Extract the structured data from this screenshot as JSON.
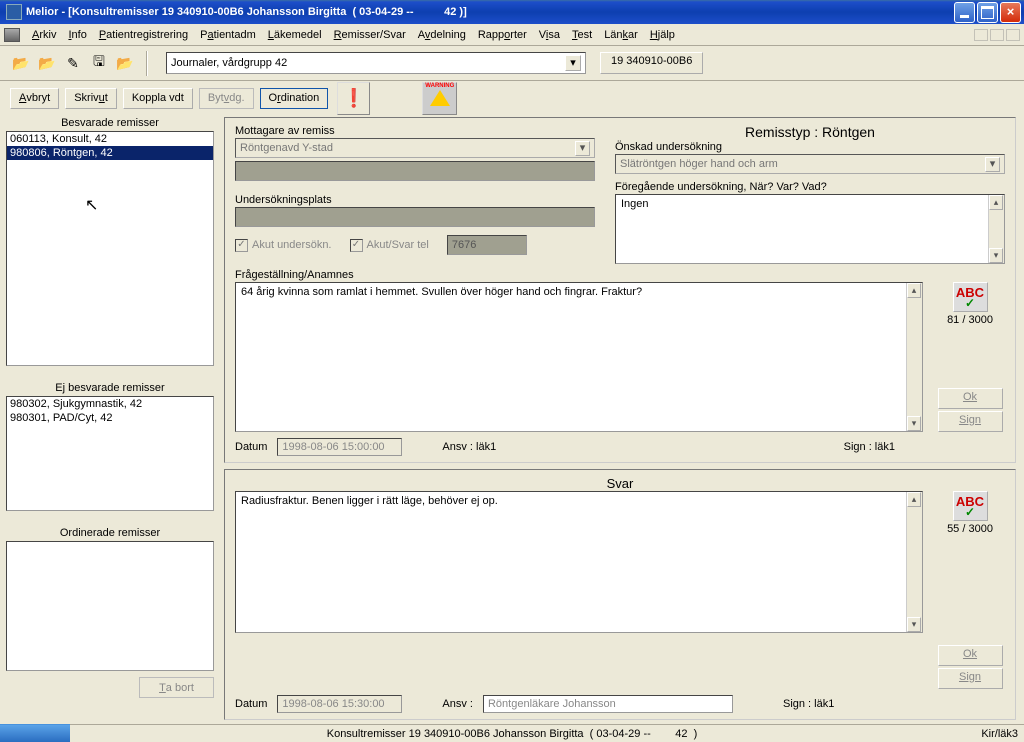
{
  "title": "Melior - [Konsultremisser 19 340910-00B6 Johansson Birgitta  ( 03-04-29 --          42 )]",
  "menu": [
    "Arkiv",
    "Info",
    "Patientregistrering",
    "Patientadm",
    "Läkemedel",
    "Remisser/Svar",
    "Avdelning",
    "Rapporter",
    "Visa",
    "Test",
    "Länkar",
    "Hjälp"
  ],
  "journal_select": "Journaler, vårdgrupp 42",
  "id_button": "19 340910-00B6",
  "sub_buttons": {
    "avbryt": "Avbryt",
    "skriv": "Skriv ut",
    "koppla": "Koppla vdt",
    "byt": "Byt vdg.",
    "ord": "Ordination"
  },
  "warning_label": "WARNING",
  "left": {
    "besvarade_label": "Besvarade remisser",
    "besvarade_items": [
      "060113, Konsult, 42",
      "980806, Röntgen, 42"
    ],
    "ej_label": "Ej besvarade remisser",
    "ej_items": [
      "980302, Sjukgymnastik, 42",
      "980301, PAD/Cyt, 42"
    ],
    "ord_label": "Ordinerade remisser",
    "tabort": "Ta bort"
  },
  "form": {
    "mottagare_label": "Mottagare av remiss",
    "mottagare_value": "Röntgenavd Y-stad",
    "remisstyp": "Remisstyp : Röntgen",
    "onskad_label": "Önskad undersökning",
    "onskad_value": "Slätröntgen höger hand och arm",
    "foregaende_label": "Föregående undersökning, När? Var? Vad?",
    "foregaende_value": "Ingen",
    "undersok_label": "Undersökningsplats",
    "akut1": "Akut undersökn.",
    "akut2": "Akut/Svar tel",
    "akut_nr": "7676",
    "fraga_label": "Frågeställning/Anamnes",
    "fraga_text": "64 årig kvinna som ramlat i hemmet. Svullen över höger hand och fingrar. Fraktur?",
    "count1": "81 / 3000",
    "datum1_label": "Datum",
    "datum1": "1998-08-06 15:00:00",
    "ansv1": "Ansv : läk1",
    "sign1": "Sign : läk1",
    "ok": "Ok",
    "sign": "Sign",
    "svar_title": "Svar",
    "svar_text": "Radiusfraktur. Benen ligger i rätt läge, behöver ej op.",
    "count2": "55 / 3000",
    "datum2": "1998-08-06 15:30:00",
    "ansv2_label": "Ansv :",
    "ansv2_value": "Röntgenläkare Johansson",
    "sign2": "Sign : läk1"
  },
  "abc": "ABC",
  "status_center": "Konsultremisser 19 340910-00B6 Johansson Birgitta  ( 03-04-29 --        42  )",
  "status_right": "Kir/läk3"
}
